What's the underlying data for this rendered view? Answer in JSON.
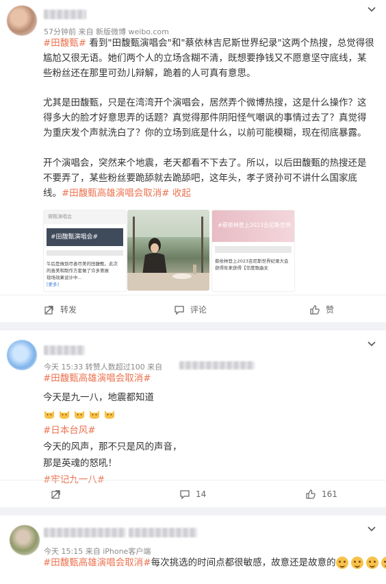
{
  "post": {
    "time": "57分钟前",
    "source": "来自 新版微博 weibo.com",
    "para1_tag": "#田馥甄#",
    "para1_text": " 看到\"田馥甄演唱会\"和\"蔡依林吉尼斯世界纪录\"这两个热搜，总觉得很尴尬又很无语。她们两个人的立场含糊不清，既想要挣钱又不愿意坚守底线，某些粉丝还在那里可劲儿辩解，跪着的人可真有意思。",
    "para2": "尤其是田馥甄，只是在湾湾开个演唱会，居然弄个微博热搜，这是什么操作？这得多大的脸才好意思弄的话题？真觉得那件阴阳怪气嘲讽的事情过去了？真觉得为重庆发个声就洗白了？你的立场到底是什么，以前可能模糊，现在彻底暴露。",
    "para3_text": "开个演唱会，突然来个地震，老天都看不下去了。所以，以后田馥甄的热搜还是不要弄了，某些粉丝要跪舔就去跪舔吧，这年头，孝子贤孙可不讲什么国家底线。",
    "para3_tag": "#田馥甄高雄演唱会取消#",
    "collapse": " 收起",
    "thumbs": [
      {
        "title": "#田馥甄演唱会#",
        "line1": "午后是做到尽善尽美的田馥甄，此次",
        "line2": "的善美和制作方套做了许多第展",
        "line3": "现场效果设计中…",
        "more": "[更多]",
        "top": "微甄演唱会"
      },
      {
        "title": "",
        "line1": "",
        "line2": "",
        "line3": "",
        "more": "",
        "top": ""
      },
      {
        "title": "#蔡依林登上2023吉尼斯世界纪录",
        "line1": "蔡依林登上2023吉尼斯世界纪录大会",
        "line2": "获得年来获得【华度歌曲女",
        "line3": "",
        "more": "",
        "top": "#蔡依林登上2023吉尼斯世界纪录#"
      }
    ],
    "actions": {
      "forward": "转发",
      "comment": "评论",
      "like": "赞"
    }
  },
  "reply1": {
    "meta": "今天 15:33 转赞人数超过100  来自",
    "tag1": "#田馥甄高雄演唱会取消#",
    "line1": "今天是九一八，地震都知道",
    "emoji_count": 5,
    "tag2": "#日本台风#",
    "line2": "今天的风声，那不只是风的声音，",
    "line3": "那是英魂的怒吼！",
    "tag3": "#牢记九一八#",
    "actions": {
      "forward": "",
      "comment": "14",
      "like": "161"
    }
  },
  "reply2": {
    "meta": "今天 15:15  来自 iPhone客户端",
    "tag": "#田馥甄高雄演唱会取消#",
    "text": "每次挑选的时间点都很敏感，故意还是故意的"
  }
}
